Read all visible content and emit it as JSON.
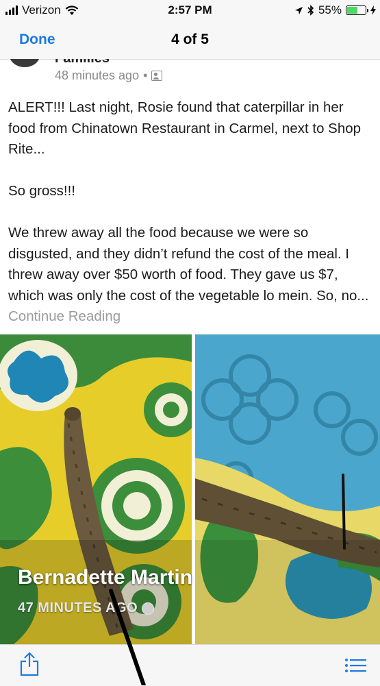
{
  "status_bar": {
    "carrier": "Verizon",
    "time": "2:57 PM",
    "battery_percent": "55%",
    "battery_level": 0.55,
    "battery_color": "#4cd964"
  },
  "nav": {
    "done_label": "Done",
    "title": "4 of 5",
    "accent_color": "#1e7ae0"
  },
  "post": {
    "group_name": "Families",
    "time_ago": "48 minutes ago",
    "separator": "•",
    "audience_icon": "group-icon",
    "paragraph_1": "ALERT!!! Last night, Rosie found that caterpillar in her food from Chinatown Restaurant in Carmel, next to Shop Rite...",
    "paragraph_2": "So gross!!!",
    "paragraph_3": "We threw away all the food because we were so disgusted, and they didn’t refund the cost of the meal.  I threw away over $50 worth of food.  They gave us $7, which was only the cost of the vegetable lo mein.  So, no...",
    "continue_label": "Continue Reading"
  },
  "photo_overlay": {
    "author": "Bernadette Martin",
    "timestamp": "47 MINUTES AGO",
    "privacy_icon": "globe-icon"
  },
  "toolbar": {
    "share_icon": "share-icon",
    "list_icon": "list-icon"
  }
}
